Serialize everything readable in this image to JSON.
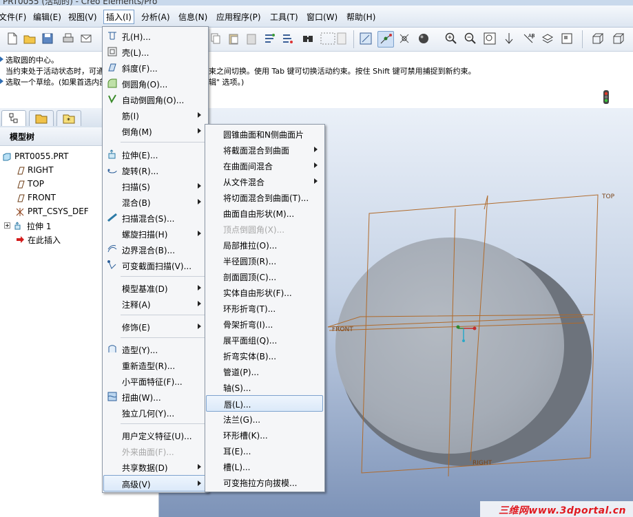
{
  "window": {
    "title": "PRT0055 (活动的) - Creo Elements/Pro"
  },
  "menubar": {
    "items": [
      "文件(F)",
      "编辑(E)",
      "视图(V)",
      "插入(I)",
      "分析(A)",
      "信息(N)",
      "应用程序(P)",
      "工具(T)",
      "窗口(W)",
      "帮助(H)"
    ]
  },
  "messages": [
    "选取圆的中心。",
    "当约束处于活动状态时，可通",
    "束之间切换。使用 Tab 键可切换活动约束。按住 Shift 键可禁用捕捉到新约束。",
    "选取一个草绘。(如果首选内部",
    "辑\" 选项。)"
  ],
  "model_tree": {
    "title": "模型树",
    "items": [
      "PRT0055.PRT",
      "RIGHT",
      "TOP",
      "FRONT",
      "PRT_CSYS_DEF",
      "拉伸 1",
      "在此插入"
    ]
  },
  "insert_menu": {
    "items": [
      {
        "label": "孔(H)...",
        "icon": "hole-icon"
      },
      {
        "label": "壳(L)...",
        "icon": "shell-icon"
      },
      {
        "label": "斜度(F)...",
        "icon": "draft-icon"
      },
      {
        "label": "倒圆角(O)...",
        "icon": "round-icon"
      },
      {
        "label": "自动倒圆角(O)...",
        "icon": "auto-round-icon"
      },
      {
        "label": "筋(I)",
        "icon": ""
      },
      {
        "label": "倒角(M)",
        "icon": ""
      },
      {
        "label": "拉伸(E)...",
        "icon": "extrude-icon"
      },
      {
        "label": "旋转(R)...",
        "icon": "revolve-icon"
      },
      {
        "label": "扫描(S)",
        "icon": ""
      },
      {
        "label": "混合(B)",
        "icon": ""
      },
      {
        "label": "扫描混合(S)...",
        "icon": "swept-blend-icon"
      },
      {
        "label": "螺旋扫描(H)",
        "icon": ""
      },
      {
        "label": "边界混合(B)...",
        "icon": "boundary-blend-icon"
      },
      {
        "label": "可变截面扫描(V)...",
        "icon": "var-sweep-icon"
      },
      {
        "label": "模型基准(D)",
        "icon": ""
      },
      {
        "label": "注释(A)",
        "icon": ""
      },
      {
        "label": "修饰(E)",
        "icon": ""
      },
      {
        "label": "造型(Y)...",
        "icon": "style-icon"
      },
      {
        "label": "重新造型(R)...",
        "icon": ""
      },
      {
        "label": "小平面特征(F)...",
        "icon": ""
      },
      {
        "label": "扭曲(W)...",
        "icon": "warp-icon"
      },
      {
        "label": "独立几何(Y)...",
        "icon": ""
      },
      {
        "label": "用户定义特征(U)...",
        "icon": ""
      },
      {
        "label": "外来曲面(F)...",
        "icon": ""
      },
      {
        "label": "共享数据(D)",
        "icon": ""
      },
      {
        "label": "高级(V)",
        "icon": ""
      }
    ]
  },
  "advanced_menu": {
    "items": [
      "圆锥曲面和N侧曲面片",
      "将截面混合到曲面",
      "在曲面间混合",
      "从文件混合",
      "将切面混合到曲面(T)...",
      "曲面自由形状(M)...",
      "顶点倒圆角(X)...",
      "局部推拉(O)...",
      "半径圆顶(R)...",
      "剖面圆顶(C)...",
      "实体自由形状(F)...",
      "环形折弯(T)...",
      "骨架折弯(I)...",
      "展平面组(Q)...",
      "折弯实体(B)...",
      "管道(P)...",
      "轴(S)...",
      "唇(L)...",
      "法兰(G)...",
      "环形槽(K)...",
      "耳(E)...",
      "槽(L)...",
      "可变拖拉方向拔模..."
    ]
  },
  "viewport": {
    "datum_labels": [
      "TOP",
      "FRONT",
      "RIGHT"
    ],
    "colors": {
      "part": "#a9b0b9",
      "datum": "#b06a2a",
      "background_top": "#eaf0f8",
      "background_bottom": "#7d93b8"
    }
  },
  "watermark": "三维网www.3dportal.cn"
}
